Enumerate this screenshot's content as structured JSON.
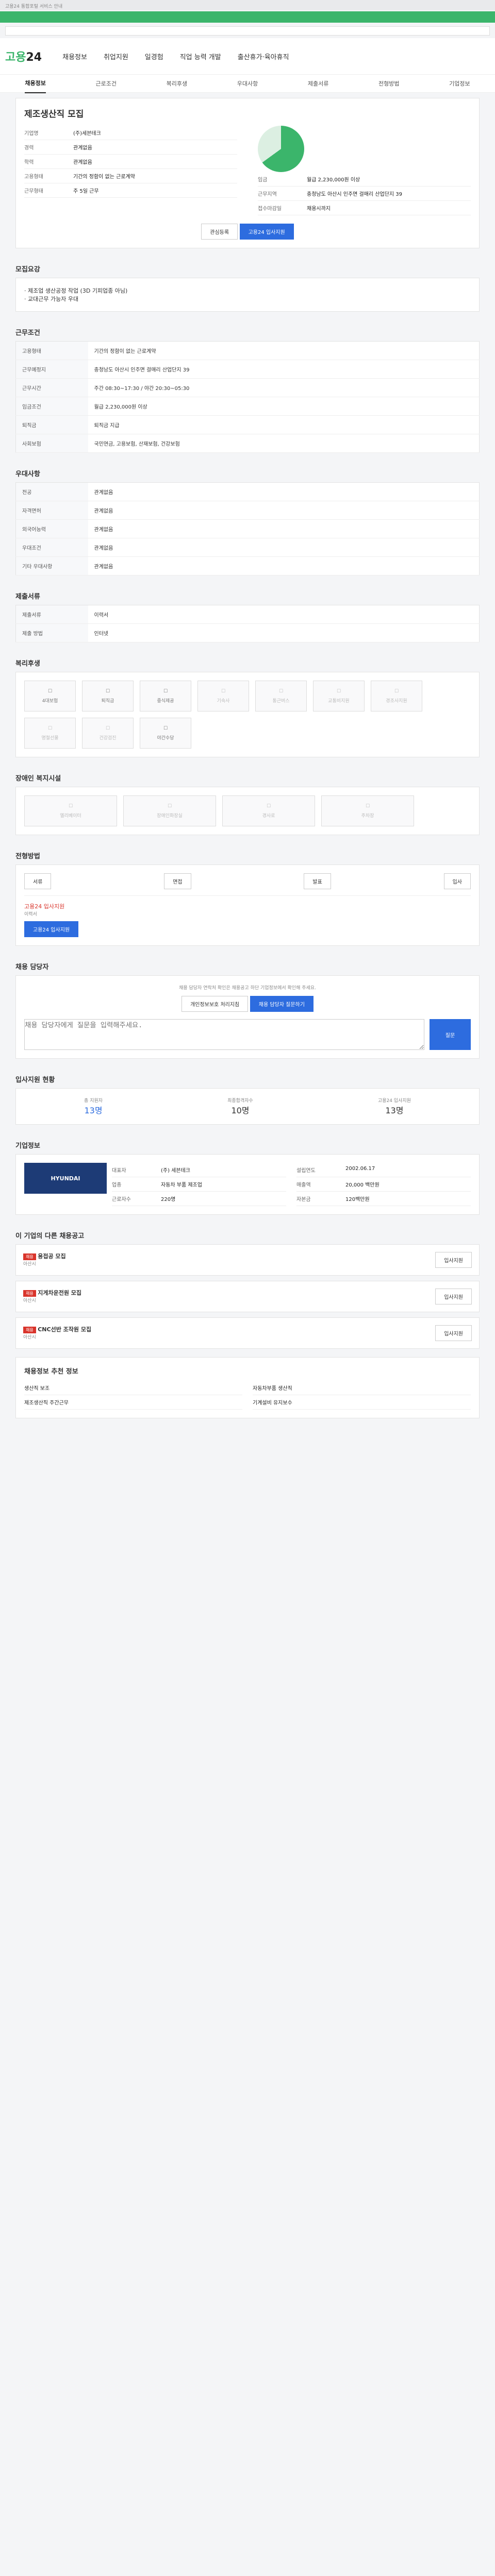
{
  "top": {
    "notice": "고용24 통합포털 서비스 안내"
  },
  "header": {
    "logo_a": "고용",
    "logo_b": "24",
    "nav": [
      "채용정보",
      "취업지원",
      "일경험",
      "직업 능력 개발",
      "출산휴가·육아휴직"
    ]
  },
  "tabs": [
    "채용정보",
    "근로조건",
    "복리후생",
    "우대사항",
    "제출서류",
    "전형방법",
    "기업정보"
  ],
  "job": {
    "title": "제조생산직 모집",
    "company_label": "기업명",
    "company": "(주)세븐테크",
    "career_label": "경력",
    "career": "관계없음",
    "edu_label": "학력",
    "edu": "관계없음",
    "wage_label": "임금",
    "wage": "월급 2,230,000원 이상",
    "loc_label": "근무지역",
    "loc": "충청남도 아산시 인주면 걸매리 산업단지 39",
    "emp_label": "고용형태",
    "emp": "기간의 정함이 없는 근로계약",
    "work_label": "근무형태",
    "work": "주 5일 근무",
    "deadline_label": "접수마감일",
    "deadline": "채용시까지",
    "apply_btn": "입사지원",
    "fav_btn": "관심등록",
    "apply_main": "고용24 입사지원"
  },
  "sections": {
    "req": {
      "title": "모집요강",
      "text": "· 제조업 생산공정 작업 (3D 기피업종 아님)\n· 교대근무 가능자 우대"
    },
    "cond": {
      "title": "근무조건",
      "rows": [
        [
          "고용형태",
          "기간의 정함이 없는 근로계약"
        ],
        [
          "근무예정지",
          "충청남도 아산시 인주면 걸매리 산업단지 39"
        ],
        [
          "근무시간",
          "주간 08:30~17:30 / 야간 20:30~05:30"
        ],
        [
          "임금조건",
          "월급 2,230,000원 이상"
        ],
        [
          "퇴직금",
          "퇴직금 지급"
        ],
        [
          "사회보험",
          "국민연금, 고용보험, 산재보험, 건강보험"
        ]
      ]
    },
    "pref": {
      "title": "우대사항",
      "rows": [
        [
          "전공",
          "관계없음"
        ],
        [
          "자격면허",
          "관계없음"
        ],
        [
          "외국어능력",
          "관계없음"
        ],
        [
          "우대조건",
          "관계없음"
        ],
        [
          "기타 우대사항",
          "관계없음"
        ]
      ]
    },
    "doc": {
      "title": "제출서류",
      "rows": [
        [
          "제출서류",
          "이력서"
        ],
        [
          "제출 방법",
          "인터넷"
        ]
      ]
    },
    "welfare": {
      "title": "복리후생",
      "items": [
        "4대보험",
        "퇴직금",
        "중식제공",
        "기숙사",
        "통근버스",
        "교통비지원",
        "경조사지원",
        "명절선물",
        "건강검진",
        "야간수당"
      ]
    },
    "disab": {
      "title": "장애인 복지시설",
      "items": [
        "엘리베이터",
        "장애인화장실",
        "경사로",
        "주차장"
      ]
    },
    "process": {
      "title": "전형방법",
      "steps": [
        "서류",
        "면접",
        "발표",
        "입사"
      ],
      "apply_method": "고용24 입사지원",
      "receive": "이력서",
      "btn": "고용24 입사지원"
    },
    "manager": {
      "title": "채용 담당자",
      "notice": "채용 담당자 연락처 확인은 채용공고 하단 기업정보에서 확인해 주세요.",
      "btn1": "개인정보보호 처리지침",
      "btn2": "채용 담당자 질문하기",
      "qa_placeholder": "채용 담당자에게 질문을 입력해주세요.",
      "submit": "질문"
    },
    "stats": {
      "title": "입사지원 현황",
      "items": [
        [
          "총 지원자",
          "13명"
        ],
        [
          "최종합격자수",
          "10명"
        ],
        [
          "고용24 입사지원",
          "13명"
        ]
      ]
    },
    "company": {
      "title": "기업정보",
      "name": "(주)세븐테크",
      "rows": [
        [
          "대표자",
          "(주) 세븐테크"
        ],
        [
          "업종",
          "자동차 부품 제조업"
        ],
        [
          "근로자수",
          "220명"
        ],
        [
          "설립연도",
          "2002.06.17"
        ],
        [
          "매출액",
          "20,000 백만원"
        ],
        [
          "자본금",
          "120백만원"
        ]
      ],
      "brand": "HYUNDAI"
    },
    "related": {
      "title": "이 기업의 다른 채용공고",
      "jobs": [
        [
          "용접공 모집",
          "아산시"
        ],
        [
          "지게차운전원 모집",
          "아산시"
        ],
        [
          "CNC선반 조작원 모집",
          "아산시"
        ]
      ]
    },
    "footer": {
      "title": "채용정보 추천 정보",
      "items": [
        "생산직 보조",
        "자동차부품 생산직",
        "제조생산직 주간근무",
        "기계설비 유지보수"
      ]
    }
  }
}
